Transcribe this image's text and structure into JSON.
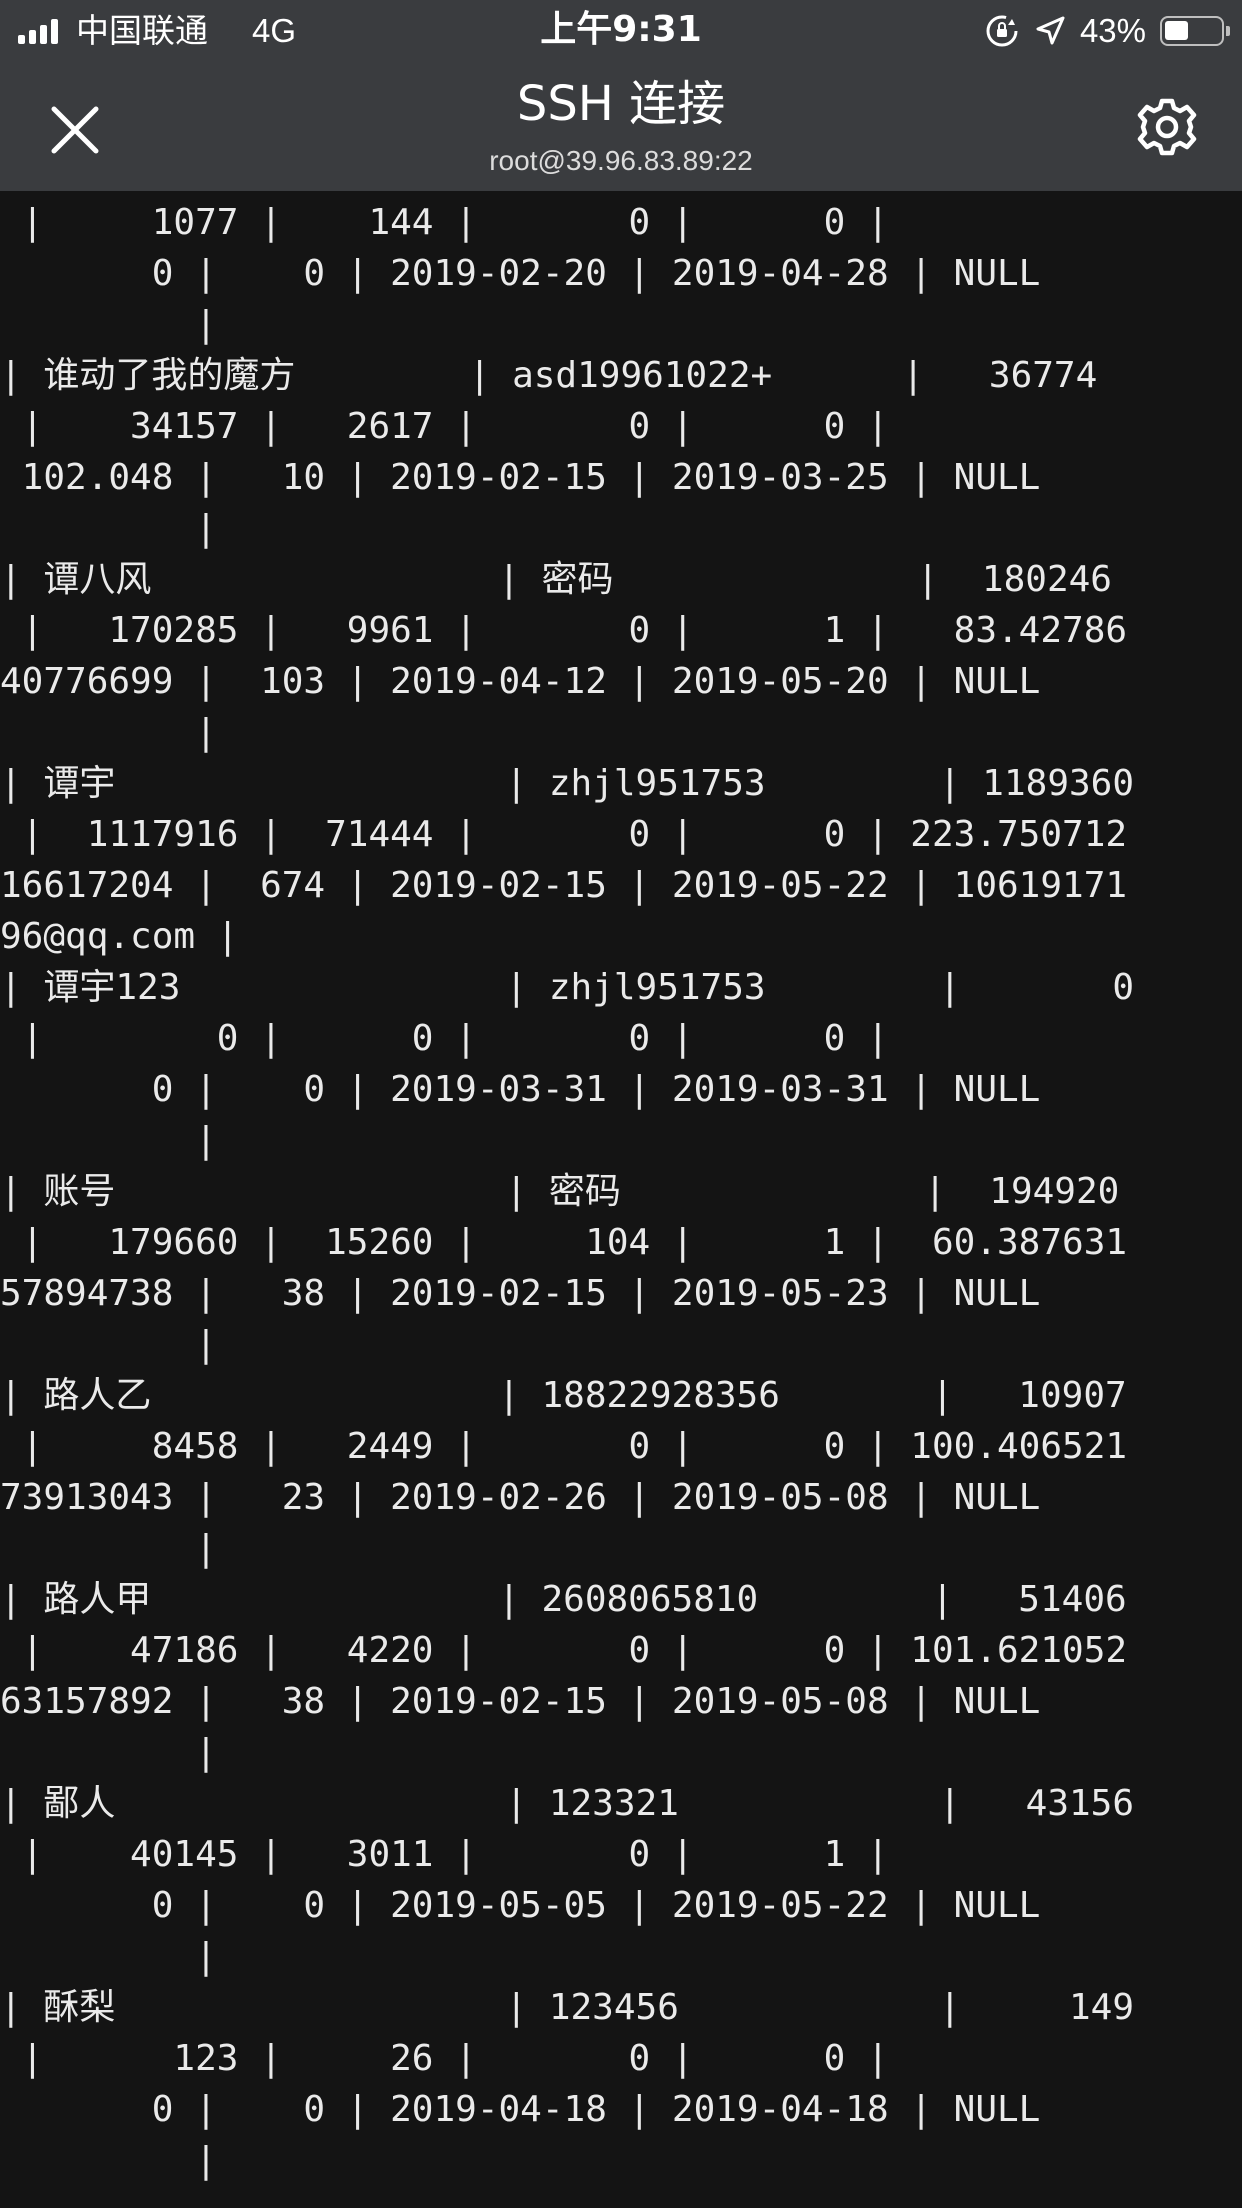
{
  "status_bar": {
    "carrier": "中国联通",
    "network": "4G",
    "time": "上午9:31",
    "battery_percent": "43%",
    "battery_level": 0.43,
    "icons": [
      "signal-bars-icon",
      "rotation-lock-icon",
      "location-arrow-icon",
      "battery-icon"
    ]
  },
  "nav": {
    "title": "SSH 连接",
    "subtitle": "root@39.96.83.89:22",
    "icons": [
      "close-icon",
      "gear-icon"
    ]
  },
  "terminal": {
    "lines": [
      " |     1077 |    144 |       0 |      0 |",
      "       0 |    0 | 2019-02-20 | 2019-04-28 | NULL",
      "         |",
      "| 谁动了我的魔方        | asd19961022+      |   36774",
      " |    34157 |   2617 |       0 |      0 |",
      " 102.048 |   10 | 2019-02-15 | 2019-03-25 | NULL",
      "         |",
      "| 谭八风                | 密码              |  180246",
      " |   170285 |   9961 |       0 |      1 |   83.42786",
      "40776699 |  103 | 2019-04-12 | 2019-05-20 | NULL",
      "         |",
      "| 谭宇                  | zhjl951753        | 1189360",
      " |  1117916 |  71444 |       0 |      0 | 223.750712",
      "16617204 |  674 | 2019-02-15 | 2019-05-22 | 10619171",
      "96@qq.com |",
      "| 谭宇123               | zhjl951753        |       0",
      " |        0 |      0 |       0 |      0 |",
      "       0 |    0 | 2019-03-31 | 2019-03-31 | NULL",
      "         |",
      "| 账号                  | 密码              |  194920",
      " |   179660 |  15260 |     104 |      1 |  60.387631",
      "57894738 |   38 | 2019-02-15 | 2019-05-23 | NULL",
      "         |",
      "| 路人乙                | 18822928356       |   10907",
      " |     8458 |   2449 |       0 |      0 | 100.406521",
      "73913043 |   23 | 2019-02-26 | 2019-05-08 | NULL",
      "         |",
      "| 路人甲                | 2608065810        |   51406",
      " |    47186 |   4220 |       0 |      0 | 101.621052",
      "63157892 |   38 | 2019-02-15 | 2019-05-08 | NULL",
      "         |",
      "| 鄙人                  | 123321            |   43156",
      " |    40145 |   3011 |       0 |      1 |",
      "       0 |    0 | 2019-05-05 | 2019-05-22 | NULL",
      "         |",
      "| 酥梨                  | 123456            |     149",
      " |      123 |     26 |       0 |      0 |",
      "       0 |    0 | 2019-04-18 | 2019-04-18 | NULL",
      "         |"
    ]
  }
}
